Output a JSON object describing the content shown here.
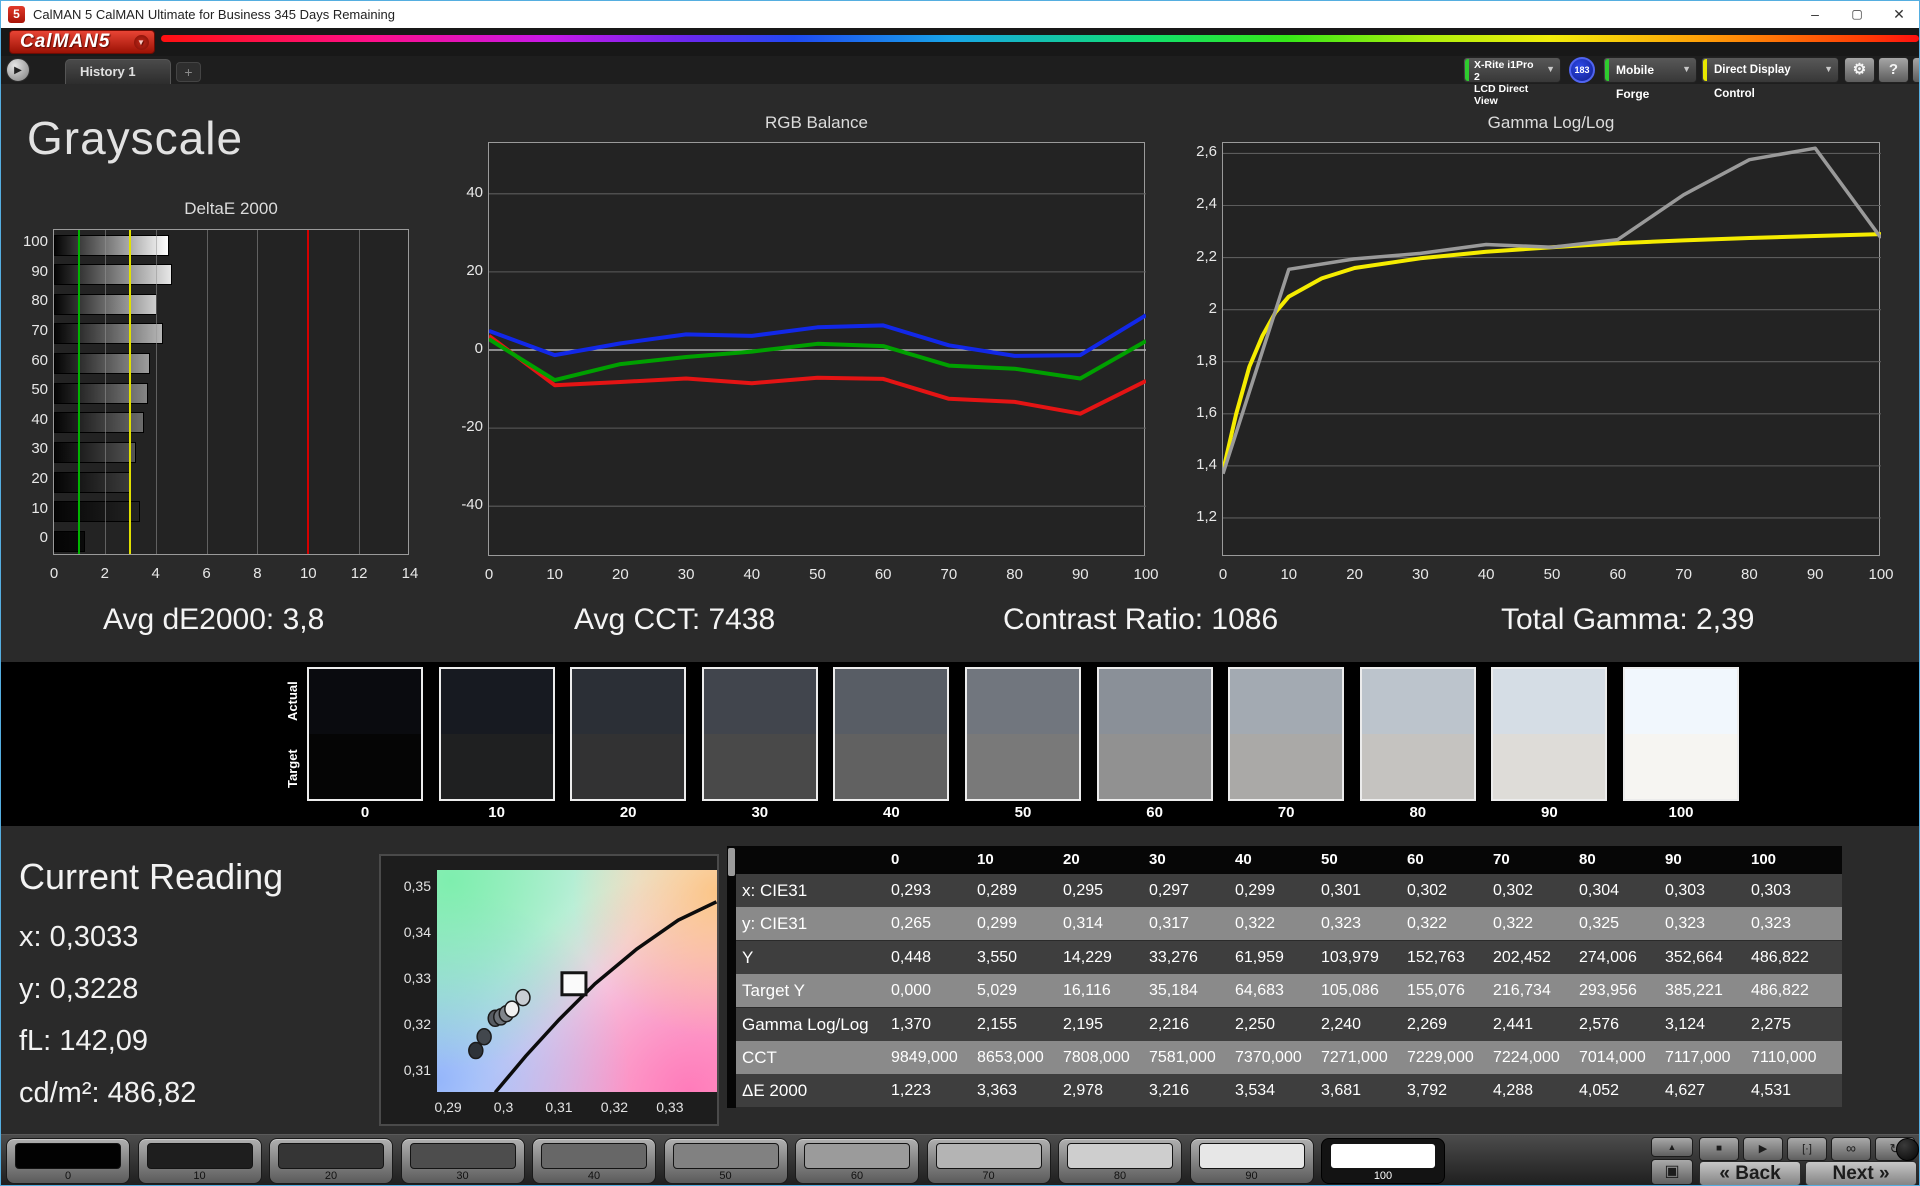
{
  "window": {
    "title": "CalMAN 5 CalMAN Ultimate for Business 345 Days Remaining",
    "app_icon": "5"
  },
  "icons": {
    "minimize": "–",
    "maximize": "▢",
    "close": "✕",
    "dropdown": "▼",
    "tab_play": "▶",
    "add": "+",
    "gear": "⚙",
    "help": "?",
    "collapse": "◀",
    "up": "▲",
    "stop": "■",
    "play": "▶",
    "frame": "[·]",
    "infinity": "∞",
    "refresh": "↻",
    "patch_window": "▣",
    "back_chevron": "«",
    "next_chevron": "»"
  },
  "logo": {
    "text": "CalMAN5"
  },
  "tabs": {
    "history": "History 1"
  },
  "devices": {
    "meter_line1": "X-Rite i1Pro 2",
    "meter_line2": "LCD Direct View",
    "badge": "183",
    "source": "Mobile Forge",
    "display_control": "Direct Display Control",
    "meter_accent": "#2ecc2e",
    "source_accent": "#2ecc2e",
    "display_accent": "#e8e800"
  },
  "page": {
    "title": "Grayscale"
  },
  "stats": [
    {
      "label": "Avg dE2000:",
      "value": "3,8"
    },
    {
      "label": "Avg CCT:",
      "value": "7438"
    },
    {
      "label": "Contrast Ratio:",
      "value": "1086"
    },
    {
      "label": "Total Gamma:",
      "value": "2,39"
    }
  ],
  "chart_data": [
    {
      "type": "bar",
      "orientation": "horizontal",
      "title": "DeltaE 2000",
      "categories": [
        100,
        90,
        80,
        70,
        60,
        50,
        40,
        30,
        20,
        10,
        0
      ],
      "values": [
        4.531,
        4.627,
        4.052,
        4.288,
        3.792,
        3.681,
        3.534,
        3.216,
        2.978,
        3.363,
        1.223
      ],
      "xlim": [
        0,
        14
      ],
      "x_ticks": [
        0,
        2,
        4,
        6,
        8,
        10,
        12,
        14
      ],
      "ref_lines": [
        {
          "value": 1,
          "color": "#00b400"
        },
        {
          "value": 3,
          "color": "#e0e000"
        },
        {
          "value": 10,
          "color": "#d40000"
        }
      ],
      "grid": true
    },
    {
      "type": "line",
      "title": "RGB Balance",
      "x": [
        0,
        10,
        20,
        30,
        40,
        50,
        60,
        70,
        80,
        90,
        100
      ],
      "series": [
        {
          "name": "Red",
          "color": "#e41414",
          "values": [
            3.6,
            -9.0,
            -8.2,
            -7.3,
            -8.5,
            -7.1,
            -7.4,
            -12.5,
            -13.3,
            -16.3,
            -7.9
          ]
        },
        {
          "name": "Green",
          "color": "#00a000",
          "values": [
            2.8,
            -7.7,
            -3.6,
            -1.8,
            -0.4,
            1.6,
            1.0,
            -4.0,
            -4.8,
            -7.3,
            2.3
          ]
        },
        {
          "name": "Blue",
          "color": "#1228e8",
          "values": [
            4.9,
            -1.3,
            1.7,
            4.0,
            3.6,
            5.8,
            6.3,
            1.2,
            -1.5,
            -1.3,
            8.9
          ]
        }
      ],
      "ylim": [
        -53,
        53
      ],
      "y_ticks": [
        40,
        20,
        0,
        -20,
        -40
      ],
      "grid": true,
      "legend": "none"
    },
    {
      "type": "line",
      "title": "Gamma Log/Log",
      "x": [
        0,
        10,
        20,
        30,
        40,
        50,
        60,
        70,
        80,
        90,
        100
      ],
      "series": [
        {
          "name": "Target",
          "color": "#f5ec00",
          "x": [
            0,
            2,
            4,
            6,
            8,
            10,
            15,
            20,
            30,
            40,
            50,
            60,
            70,
            80,
            90,
            100
          ],
          "values": [
            1.38,
            1.6,
            1.78,
            1.9,
            1.99,
            2.05,
            2.12,
            2.16,
            2.197,
            2.222,
            2.24,
            2.255,
            2.266,
            2.275,
            2.283,
            2.29
          ]
        },
        {
          "name": "Measured",
          "color": "#9a9a9a",
          "values": [
            1.37,
            2.155,
            2.195,
            2.216,
            2.25,
            2.24,
            2.269,
            2.441,
            2.576,
            3.124,
            2.275
          ],
          "clamp_max": 2.62
        }
      ],
      "ylim": [
        1.05,
        2.64
      ],
      "y_ticks": [
        2.6,
        2.4,
        2.2,
        2.0,
        1.8,
        1.6,
        1.4,
        1.2
      ],
      "y_tick_labels": [
        "2,6",
        "2,4",
        "2,2",
        "2",
        "1,8",
        "1,6",
        "1,4",
        "1,2"
      ],
      "grid": true,
      "legend": "none"
    },
    {
      "type": "scatter",
      "title": "CIE 1931 xy detail",
      "x_ticks": [
        0.29,
        0.3,
        0.31,
        0.32,
        0.33
      ],
      "x_tick_labels": [
        "0,29",
        "0,3",
        "0,31",
        "0,32",
        "0,33"
      ],
      "y_ticks": [
        0.35,
        0.34,
        0.33,
        0.32,
        0.31
      ],
      "y_tick_labels": [
        "0,35",
        "0,34",
        "0,33",
        "0,32",
        "0,31"
      ],
      "xlim": [
        0.288,
        0.3385
      ],
      "ylim": [
        0.3055,
        0.3537
      ],
      "target_square": [
        0.3127,
        0.329
      ],
      "locus": [
        [
          0.2985,
          0.3054
        ],
        [
          0.304,
          0.3133
        ],
        [
          0.31,
          0.3212
        ],
        [
          0.3165,
          0.329
        ],
        [
          0.324,
          0.3365
        ],
        [
          0.3315,
          0.3428
        ],
        [
          0.3384,
          0.3468
        ]
      ],
      "points": [
        {
          "x": 0.295,
          "y": 0.3145,
          "color": "#2e3339"
        },
        {
          "x": 0.2965,
          "y": 0.3175,
          "color": "#42474d"
        },
        {
          "x": 0.2985,
          "y": 0.3215,
          "color": "#565b61"
        },
        {
          "x": 0.2995,
          "y": 0.3218,
          "color": "#6c7177"
        },
        {
          "x": 0.3005,
          "y": 0.3225,
          "color": "#80858b"
        },
        {
          "x": 0.3015,
          "y": 0.3235,
          "color": "#f0f0f0"
        },
        {
          "x": 0.3035,
          "y": 0.326,
          "color": "#c8cdd3"
        }
      ]
    }
  ],
  "swatches": {
    "actual_label": "Actual",
    "target_label": "Target",
    "levels": [
      {
        "label": "0",
        "actual": "#0a0b0f",
        "target": "#050505"
      },
      {
        "label": "10",
        "actual": "#171a21",
        "target": "#1f2021"
      },
      {
        "label": "20",
        "actual": "#2b2f36",
        "target": "#323233"
      },
      {
        "label": "30",
        "actual": "#41454d",
        "target": "#494949"
      },
      {
        "label": "40",
        "actual": "#585d65",
        "target": "#616161"
      },
      {
        "label": "50",
        "actual": "#71767e",
        "target": "#797979"
      },
      {
        "label": "60",
        "actual": "#8a9098",
        "target": "#919191"
      },
      {
        "label": "70",
        "actual": "#a3aab2",
        "target": "#aaa9a7"
      },
      {
        "label": "80",
        "actual": "#bcc4cc",
        "target": "#c5c3c0"
      },
      {
        "label": "90",
        "actual": "#d5dde5",
        "target": "#dedcd8"
      },
      {
        "label": "100",
        "actual": "#f1f7fd",
        "target": "#f6f5f2"
      }
    ]
  },
  "current_reading": {
    "title": "Current Reading",
    "lines": [
      {
        "label": "x:",
        "value": "0,3033"
      },
      {
        "label": "y:",
        "value": "0,3228"
      },
      {
        "label": "fL:",
        "value": "142,09"
      },
      {
        "label": "cd/m²:",
        "value": "486,82"
      }
    ]
  },
  "table": {
    "header": [
      "0",
      "10",
      "20",
      "30",
      "40",
      "50",
      "60",
      "70",
      "80",
      "90",
      "100"
    ],
    "rows": [
      {
        "label": "x: CIE31",
        "values": [
          "0,293",
          "0,289",
          "0,295",
          "0,297",
          "0,299",
          "0,301",
          "0,302",
          "0,302",
          "0,304",
          "0,303",
          "0,303"
        ]
      },
      {
        "label": "y: CIE31",
        "values": [
          "0,265",
          "0,299",
          "0,314",
          "0,317",
          "0,322",
          "0,323",
          "0,322",
          "0,322",
          "0,325",
          "0,323",
          "0,323"
        ]
      },
      {
        "label": "Y",
        "values": [
          "0,448",
          "3,550",
          "14,229",
          "33,276",
          "61,959",
          "103,979",
          "152,763",
          "202,452",
          "274,006",
          "352,664",
          "486,822"
        ]
      },
      {
        "label": "Target Y",
        "values": [
          "0,000",
          "5,029",
          "16,116",
          "35,184",
          "64,683",
          "105,086",
          "155,076",
          "216,734",
          "293,956",
          "385,221",
          "486,822"
        ]
      },
      {
        "label": "Gamma Log/Log",
        "values": [
          "1,370",
          "2,155",
          "2,195",
          "2,216",
          "2,250",
          "2,240",
          "2,269",
          "2,441",
          "2,576",
          "3,124",
          "2,275"
        ]
      },
      {
        "label": "CCT",
        "values": [
          "9849,000",
          "8653,000",
          "7808,000",
          "7581,000",
          "7370,000",
          "7271,000",
          "7229,000",
          "7224,000",
          "7014,000",
          "7117,000",
          "7110,000"
        ]
      },
      {
        "label": "ΔE 2000",
        "values": [
          "1,223",
          "3,363",
          "2,978",
          "3,216",
          "3,534",
          "3,681",
          "3,792",
          "4,288",
          "4,052",
          "4,627",
          "4,531"
        ]
      }
    ]
  },
  "toolbar": {
    "patches": [
      {
        "label": "0",
        "color": "#020202"
      },
      {
        "label": "10",
        "color": "#1e1e1e"
      },
      {
        "label": "20",
        "color": "#353535"
      },
      {
        "label": "30",
        "color": "#4d4d4d"
      },
      {
        "label": "40",
        "color": "#676767"
      },
      {
        "label": "50",
        "color": "#818181"
      },
      {
        "label": "60",
        "color": "#9b9b9b"
      },
      {
        "label": "70",
        "color": "#b4b4b4"
      },
      {
        "label": "80",
        "color": "#cecece"
      },
      {
        "label": "90",
        "color": "#e7e7e7"
      },
      {
        "label": "100",
        "color": "#ffffff",
        "selected": true
      }
    ],
    "back_label": "Back",
    "next_label": "Next"
  }
}
